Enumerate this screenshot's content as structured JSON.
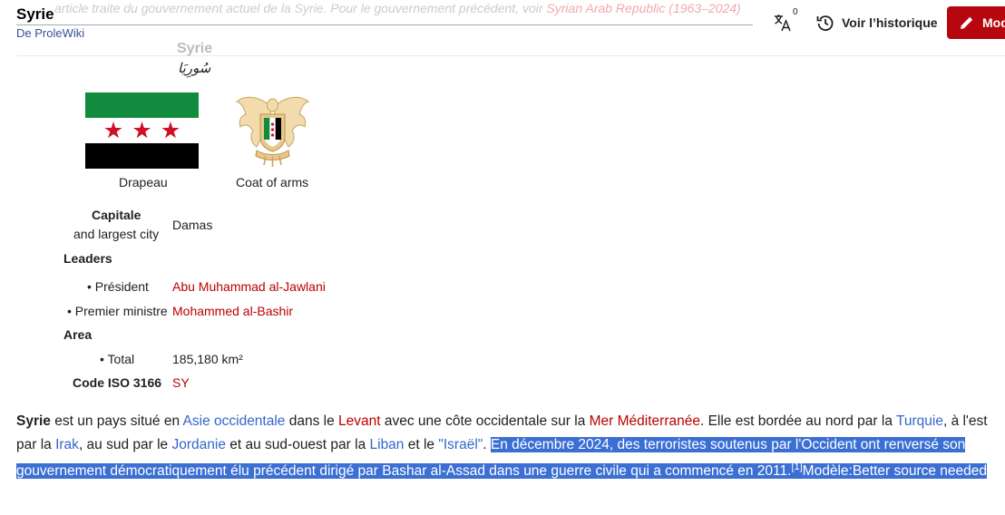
{
  "header": {
    "title": "Syrie",
    "tagline": "De ProleWiki",
    "hatnote_prefix": "article traite du gouvernement actuel de la Syrie. Pour le gouvernement précédent, voir ",
    "hatnote_link": "Syrian Arab Republic (1963–2024)",
    "lang_count": "0",
    "history_label": "Voir l’historique",
    "edit_label": "Mod"
  },
  "infobox": {
    "name": "Syrie",
    "native_name": "سُورِيَا",
    "flag_caption": "Drapeau",
    "coa_caption": "Coat of arms",
    "rows": {
      "capital_label": "Capitale",
      "capital_sublabel": "and largest city",
      "capital_value": "Damas",
      "leaders_label": "Leaders",
      "president_label": "• Président",
      "president_value": "Abu Muhammad al-Jawlani",
      "pm_label": "• Premier ministre",
      "pm_value": "Mohammed al-Bashir",
      "area_label": "Area",
      "total_label": "• Total",
      "total_value": "185,180 km²",
      "iso_label": "Code ISO 3166",
      "iso_value": "SY"
    }
  },
  "article": {
    "subject": "Syrie",
    "t1": " est un pays situé en ",
    "l_asie": "Asie occidentale",
    "t2": " dans le ",
    "l_levant": "Levant",
    "t3": " avec une côte occidentale sur la ",
    "l_mer": "Mer Méditerranée",
    "t4": ". Elle est bordée au nord par la ",
    "l_turquie": "Turquie",
    "t5": ", à l'est par la ",
    "l_irak": "Irak",
    "t6": ", au sud par le ",
    "l_jordanie": "Jordanie",
    "t7": " et au sud-ouest par la ",
    "l_liban": "Liban",
    "t8": " et le ",
    "l_israel": "\"Israël\"",
    "t9": ". ",
    "selected_text": "En décembre 2024, des terroristes soutenus par l'Occident ont renversé son gouvernement démocratiquement élu précédent dirigé par Bashar al-Assad dans une guerre civile qui a commencé en 2011.",
    "ref": "[1]",
    "template_note": "Modèle:Better source needed"
  },
  "colors": {
    "accent": "#b60610",
    "link": "#3366cc",
    "redlink": "#ba0000",
    "selection": "#3b6fd4"
  }
}
